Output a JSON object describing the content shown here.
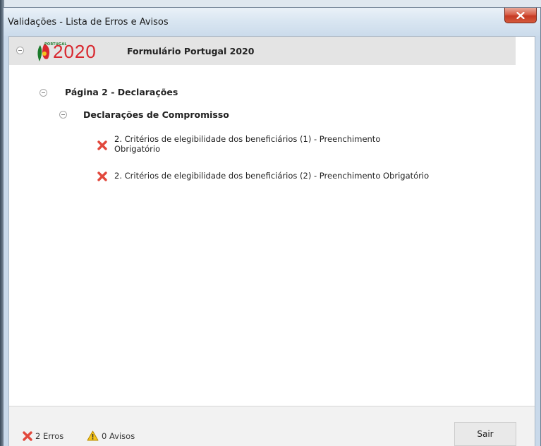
{
  "window": {
    "title": "Validações - Lista de Erros e Avisos",
    "close_icon": "close-icon"
  },
  "tree": {
    "root": {
      "label": "Formulário Portugal 2020",
      "logo_word": "PORTUGAL",
      "logo_number": "2020"
    },
    "page": {
      "label": "Página 2 - Declarações"
    },
    "section": {
      "label": "Declarações de Compromisso"
    },
    "errors": [
      {
        "text": "2. Critérios de elegibilidade dos beneficiários (1) - Preenchimento",
        "text_line2": "Obrigatório",
        "icon": "error-x-icon"
      },
      {
        "text": "2. Critérios de elegibilidade dos beneficiários (2) - Preenchimento Obrigatório",
        "icon": "error-x-icon"
      }
    ]
  },
  "footer": {
    "errors_label": "2 Erros",
    "warnings_label": "0 Avisos",
    "exit_label": "Sair"
  },
  "colors": {
    "error_red": "#e2483c",
    "warning_yellow": "#f6c51b",
    "logo_red": "#d8282f",
    "logo_green": "#1b7a2a"
  }
}
